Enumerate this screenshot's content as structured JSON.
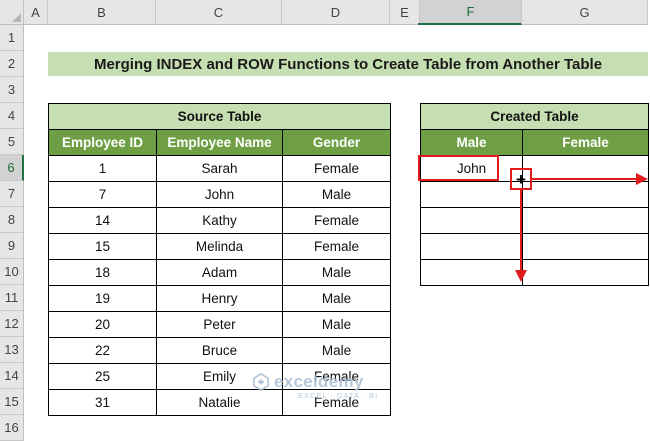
{
  "spreadsheet": {
    "columns": [
      {
        "label": "A",
        "selected": false
      },
      {
        "label": "B",
        "selected": false
      },
      {
        "label": "C",
        "selected": false
      },
      {
        "label": "D",
        "selected": false
      },
      {
        "label": "E",
        "selected": false
      },
      {
        "label": "F",
        "selected": true
      },
      {
        "label": "G",
        "selected": false
      }
    ],
    "rows": [
      {
        "label": "1",
        "selected": false
      },
      {
        "label": "2",
        "selected": false
      },
      {
        "label": "3",
        "selected": false
      },
      {
        "label": "4",
        "selected": false
      },
      {
        "label": "5",
        "selected": false
      },
      {
        "label": "6",
        "selected": true
      },
      {
        "label": "7",
        "selected": false
      },
      {
        "label": "8",
        "selected": false
      },
      {
        "label": "9",
        "selected": false
      },
      {
        "label": "10",
        "selected": false
      },
      {
        "label": "11",
        "selected": false
      },
      {
        "label": "12",
        "selected": false
      },
      {
        "label": "13",
        "selected": false
      },
      {
        "label": "14",
        "selected": false
      },
      {
        "label": "15",
        "selected": false
      },
      {
        "label": "16",
        "selected": false
      }
    ],
    "header_selection_color": "#217346"
  },
  "title": "Merging INDEX and ROW Functions to Create Table from Another Table",
  "source_table": {
    "caption": "Source Table",
    "headers": [
      "Employee ID",
      "Employee Name",
      "Gender"
    ],
    "rows": [
      [
        "1",
        "Sarah",
        "Female"
      ],
      [
        "7",
        "John",
        "Male"
      ],
      [
        "14",
        "Kathy",
        "Female"
      ],
      [
        "15",
        "Melinda",
        "Female"
      ],
      [
        "18",
        "Adam",
        "Male"
      ],
      [
        "19",
        "Henry",
        "Male"
      ],
      [
        "20",
        "Peter",
        "Male"
      ],
      [
        "22",
        "Bruce",
        "Male"
      ],
      [
        "25",
        "Emily",
        "Female"
      ],
      [
        "31",
        "Natalie",
        "Female"
      ]
    ]
  },
  "created_table": {
    "caption": "Created Table",
    "headers": [
      "Male",
      "Female"
    ],
    "rows": [
      [
        "John",
        ""
      ],
      [
        "",
        ""
      ],
      [
        "",
        ""
      ],
      [
        "",
        ""
      ],
      [
        "",
        ""
      ]
    ]
  },
  "annotations": {
    "fill_handle_icon": "crosshair-plus-icon",
    "arrow_color": "#e21c1c",
    "arrows": [
      "arrow-right-icon",
      "arrow-down-icon"
    ]
  },
  "watermark": {
    "brand": "exceldemy",
    "tagline": "EXCEL · DATA · BI"
  },
  "colors": {
    "title_fill": "#c6dfb2",
    "caption_fill": "#c6dfb2",
    "header_fill": "#6f9f45",
    "header_text": "#ffffff"
  }
}
